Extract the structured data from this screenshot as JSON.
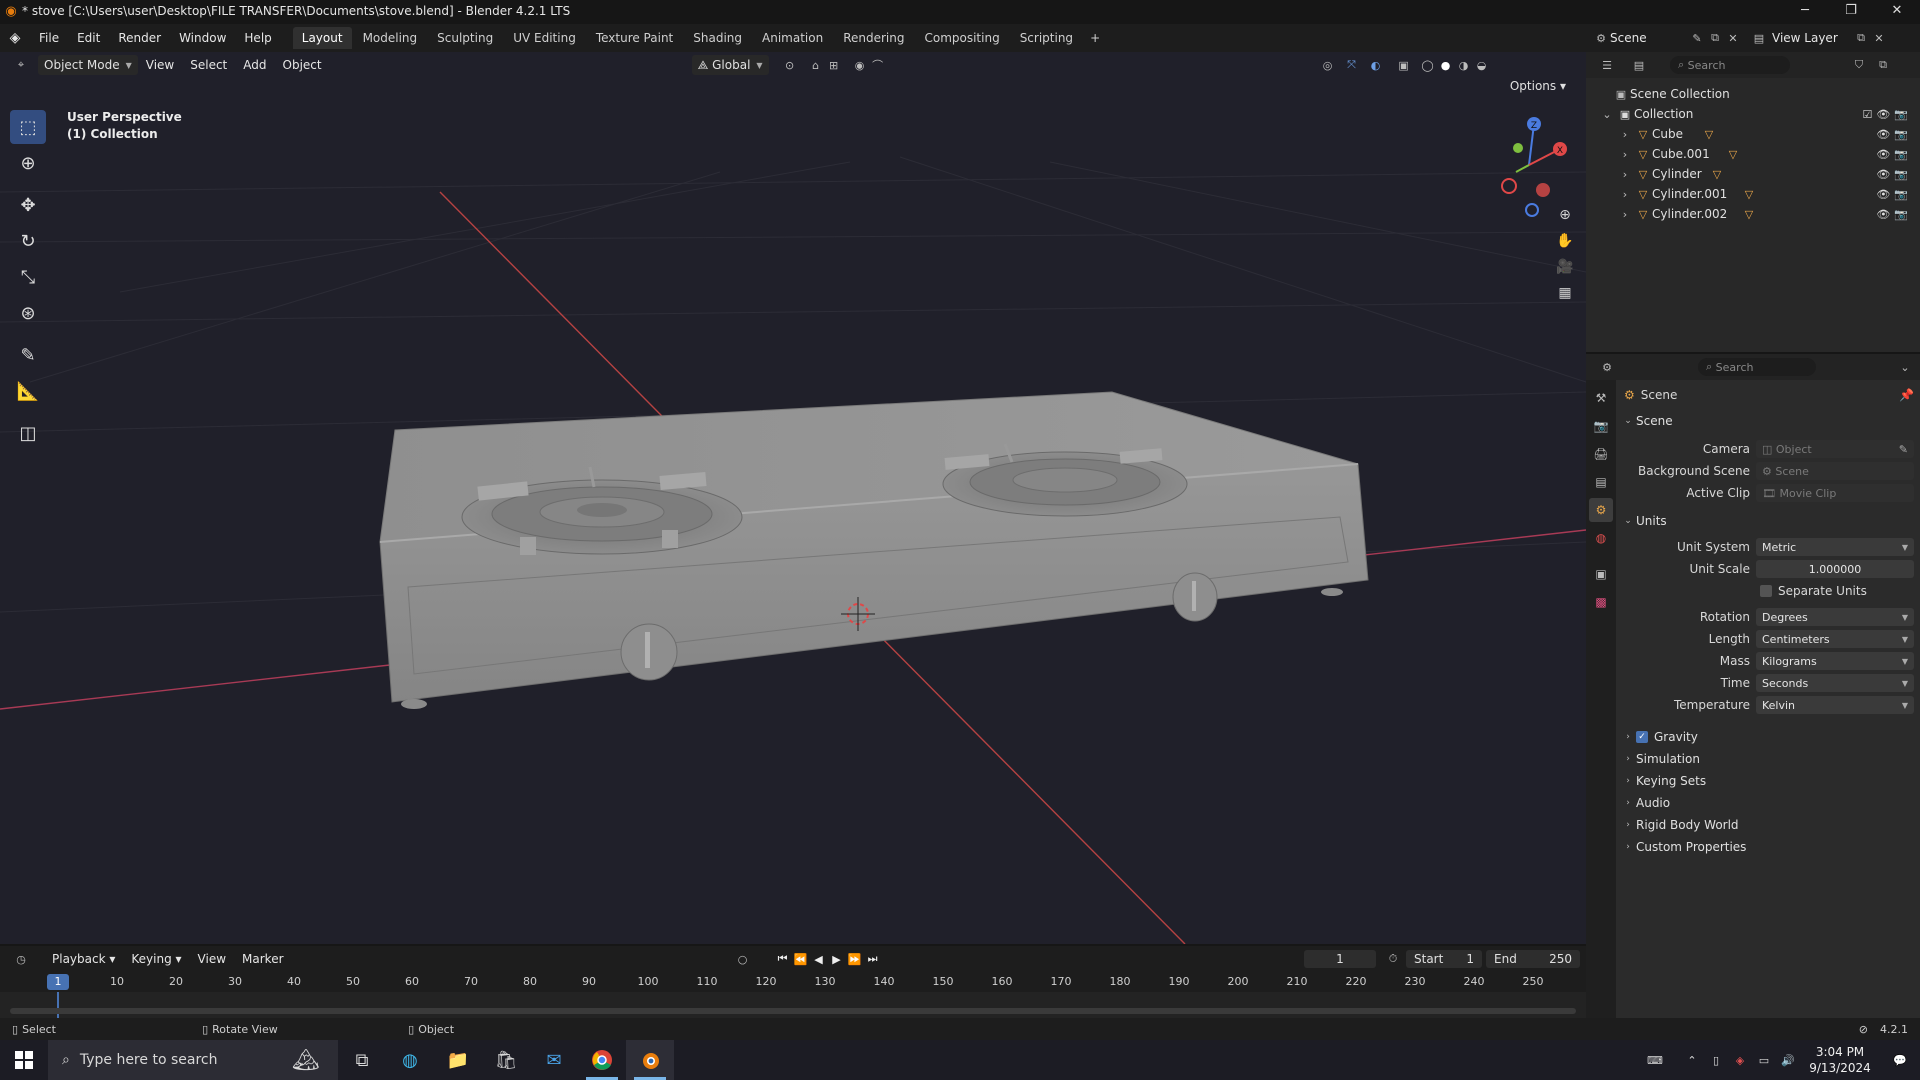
{
  "window": {
    "title": "* stove [C:\\Users\\user\\Desktop\\FILE TRANSFER\\Documents\\stove.blend] - Blender 4.2.1 LTS",
    "controls": [
      "minimize",
      "restore",
      "close"
    ]
  },
  "menus": [
    "File",
    "Edit",
    "Render",
    "Window",
    "Help"
  ],
  "workspaces": [
    {
      "label": "Layout",
      "active": true
    },
    {
      "label": "Modeling"
    },
    {
      "label": "Sculpting"
    },
    {
      "label": "UV Editing"
    },
    {
      "label": "Texture Paint"
    },
    {
      "label": "Shading"
    },
    {
      "label": "Animation"
    },
    {
      "label": "Rendering"
    },
    {
      "label": "Compositing"
    },
    {
      "label": "Scripting"
    }
  ],
  "scene_selector": {
    "scene": "Scene",
    "view_layer": "View Layer"
  },
  "viewport": {
    "mode": "Object Mode",
    "menus": [
      "View",
      "Select",
      "Add",
      "Object"
    ],
    "orientation": "Global",
    "options_label": "Options",
    "info_line1": "User Perspective",
    "info_line2": "(1) Collection",
    "gizmo_axes": {
      "z": "Z",
      "x": "X",
      "y": "Y"
    }
  },
  "outliner": {
    "search_placeholder": "Search",
    "root": "Scene Collection",
    "collection": "Collection",
    "objects": [
      "Cube",
      "Cube.001",
      "Cylinder",
      "Cylinder.001",
      "Cylinder.002"
    ]
  },
  "properties": {
    "search_placeholder": "Search",
    "context": "Scene",
    "scene_section": "Scene",
    "camera_label": "Camera",
    "camera_value": "Object",
    "bg_scene_label": "Background Scene",
    "bg_scene_value": "Scene",
    "active_clip_label": "Active Clip",
    "active_clip_value": "Movie Clip",
    "units_section": "Units",
    "unit_system_label": "Unit System",
    "unit_system_value": "Metric",
    "unit_scale_label": "Unit Scale",
    "unit_scale_value": "1.000000",
    "separate_units_label": "Separate Units",
    "rotation_label": "Rotation",
    "rotation_value": "Degrees",
    "length_label": "Length",
    "length_value": "Centimeters",
    "mass_label": "Mass",
    "mass_value": "Kilograms",
    "time_label": "Time",
    "time_value": "Seconds",
    "temperature_label": "Temperature",
    "temperature_value": "Kelvin",
    "collapsed_sections": [
      "Gravity",
      "Simulation",
      "Keying Sets",
      "Audio",
      "Rigid Body World",
      "Custom Properties"
    ]
  },
  "timeline": {
    "menus": [
      "Playback",
      "Keying",
      "View",
      "Marker"
    ],
    "current_frame": "1",
    "start_label": "Start",
    "start_value": "1",
    "end_label": "End",
    "end_value": "250",
    "ruler": [
      "10",
      "20",
      "30",
      "40",
      "50",
      "60",
      "70",
      "80",
      "90",
      "100",
      "110",
      "120",
      "130",
      "140",
      "150",
      "160",
      "170",
      "180",
      "190",
      "200",
      "210",
      "220",
      "230",
      "240",
      "250"
    ]
  },
  "statusbar": {
    "select": "Select",
    "rotate": "Rotate View",
    "object": "Object",
    "version": "4.2.1"
  },
  "taskbar": {
    "search_placeholder": "Type here to search",
    "time": "3:04 PM",
    "date": "9/13/2024"
  },
  "colors": {
    "accent": "#4772b3",
    "x_axis": "#e04848",
    "y_axis": "#7fbf3f",
    "z_axis": "#4a7be0",
    "blender_orange": "#e87d0d"
  }
}
